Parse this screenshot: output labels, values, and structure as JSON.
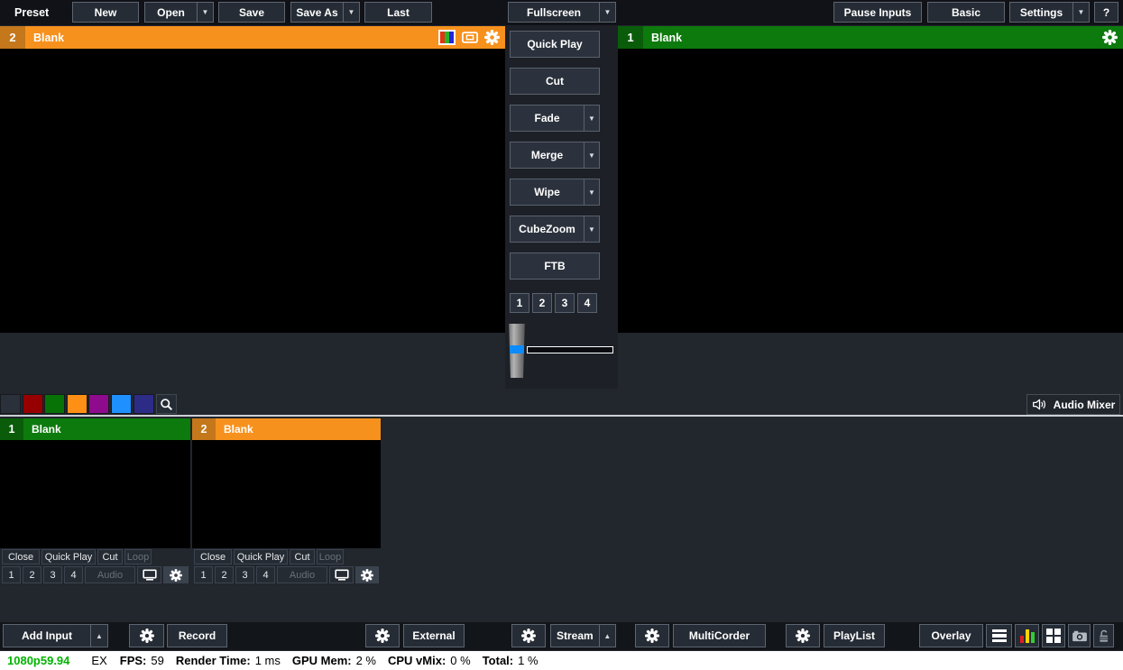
{
  "toolbar_top": {
    "preset_label": "Preset",
    "buttons": {
      "new": "New",
      "open": "Open",
      "save": "Save",
      "save_as": "Save As",
      "last": "Last",
      "fullscreen": "Fullscreen",
      "pause_inputs": "Pause Inputs",
      "basic": "Basic",
      "settings": "Settings",
      "help": "?"
    }
  },
  "preview_left": {
    "number": "2",
    "title": "Blank"
  },
  "preview_right": {
    "number": "1",
    "title": "Blank"
  },
  "transition_panel": {
    "quick_play": "Quick Play",
    "cut": "Cut",
    "fade": "Fade",
    "merge": "Merge",
    "wipe": "Wipe",
    "cube_zoom": "CubeZoom",
    "ftb": "FTB",
    "overlay_numbers": [
      "1",
      "2",
      "3",
      "4"
    ]
  },
  "audio_mixer": {
    "label": "Audio Mixer"
  },
  "inputs": [
    {
      "number": "1",
      "title": "Blank"
    },
    {
      "number": "2",
      "title": "Blank"
    }
  ],
  "input_controls": {
    "close": "Close",
    "quick_play": "Quick Play",
    "cut": "Cut",
    "loop": "Loop",
    "audio": "Audio",
    "numbers": [
      "1",
      "2",
      "3",
      "4"
    ]
  },
  "toolbar_bottom": {
    "add_input": "Add Input",
    "record": "Record",
    "external": "External",
    "stream": "Stream",
    "multicorder": "MultiCorder",
    "playlist": "PlayList",
    "overlay": "Overlay"
  },
  "status_bar": {
    "resolution": "1080p59.94",
    "ex": "EX",
    "fps_label": "FPS:",
    "fps_value": "59",
    "render_label": "Render Time:",
    "render_value": "1 ms",
    "gpu_label": "GPU Mem:",
    "gpu_value": "2 %",
    "cpu_label": "CPU vMix:",
    "cpu_value": "0 %",
    "total_label": "Total:",
    "total_value": "1 %"
  },
  "colors": {
    "preview_accent": "#f7911d",
    "preview_accent_dark": "#c4771b",
    "program_accent": "#0d7a0d",
    "program_accent_dark": "#0a5c0a",
    "tbar_blue": "#0a8cff",
    "resolution_green": "#00b400",
    "swatches": [
      "#2b313a",
      "#970000",
      "#077307",
      "#ff9015",
      "#8f0b8d",
      "#1e90ff",
      "#2c2c86"
    ]
  }
}
